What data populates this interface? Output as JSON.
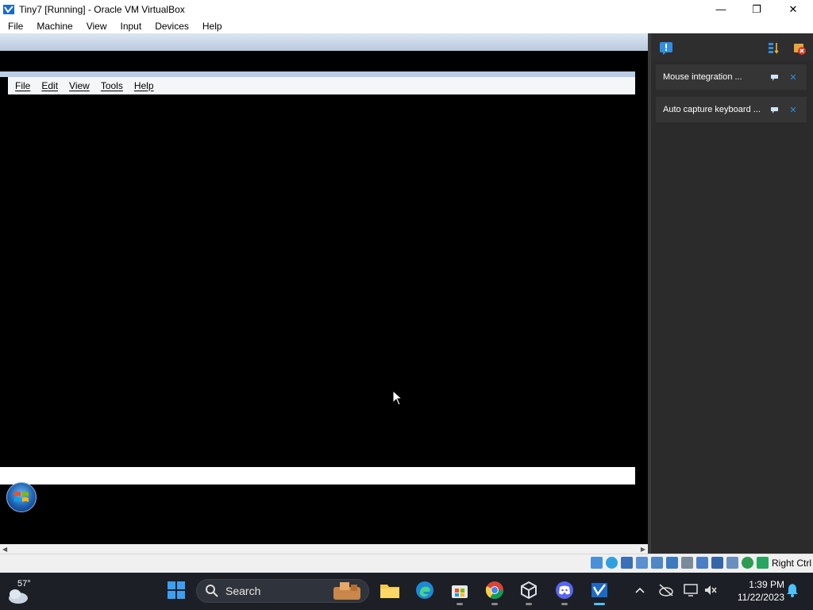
{
  "window": {
    "title": "Tiny7 [Running] - Oracle VM VirtualBox",
    "controls": {
      "minimize": "—",
      "maximize": "❐",
      "close": "✕"
    }
  },
  "menubar": [
    "File",
    "Machine",
    "View",
    "Input",
    "Devices",
    "Help"
  ],
  "guest": {
    "menu": [
      "File",
      "Edit",
      "View",
      "Tools",
      "Help"
    ]
  },
  "notifications": [
    {
      "text": "Mouse integration ..."
    },
    {
      "text": "Auto capture keyboard ..."
    }
  ],
  "statusbar": {
    "host_key": "Right Ctrl"
  },
  "taskbar": {
    "weather_temp": "57°",
    "search_placeholder": "Search",
    "time": "1:39 PM",
    "date": "11/22/2023"
  },
  "colors": {
    "accent": "#1d9bf0",
    "notif_bg": "#353535",
    "taskbar_bg": "#1c1f26"
  }
}
